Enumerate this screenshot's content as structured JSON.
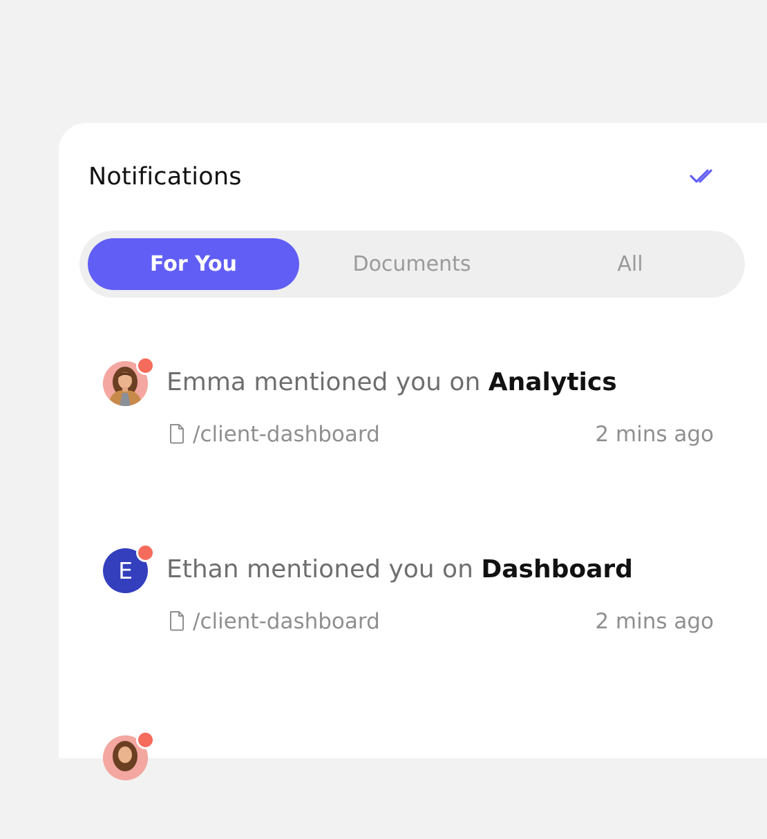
{
  "header": {
    "title": "Notifications",
    "mark_all_icon": "double-check-icon"
  },
  "tabs": [
    {
      "label": "For You",
      "active": true
    },
    {
      "label": "Documents",
      "active": false
    },
    {
      "label": "All",
      "active": false
    }
  ],
  "notifications": [
    {
      "user": "Emma",
      "action": "mentioned you on",
      "target": "Analytics",
      "path": "/client-dashboard",
      "time": "2 mins ago",
      "avatar_type": "photo",
      "unread": true
    },
    {
      "user": "Ethan",
      "action": "mentioned you on",
      "target": "Dashboard",
      "path": "/client-dashboard",
      "time": "2 mins ago",
      "avatar_type": "letter",
      "avatar_letter": "E",
      "unread": true
    },
    {
      "avatar_type": "photo",
      "unread": true
    }
  ],
  "colors": {
    "accent": "#615ef5",
    "unread_dot": "#f56b5c",
    "avatar_letter_bg": "#333fbd",
    "background": "#f2f2f2",
    "tabs_bg": "#efefef"
  }
}
